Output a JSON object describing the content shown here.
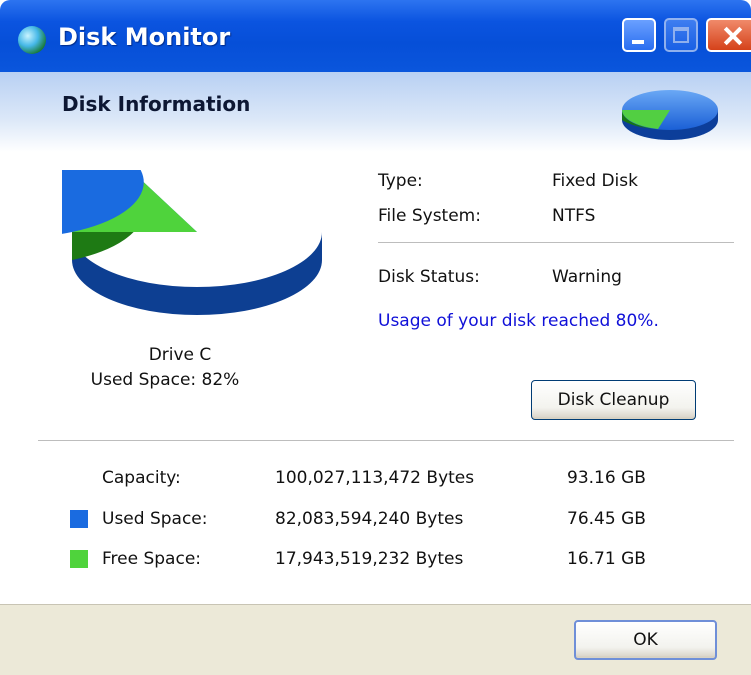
{
  "window": {
    "title": "Disk Monitor",
    "buttons": [
      "minimize",
      "maximize",
      "close"
    ]
  },
  "header": {
    "title": "Disk Information"
  },
  "drive": {
    "name": "Drive C",
    "used_label": "Used Space: 82%",
    "used_fraction": 0.82
  },
  "info": {
    "type_label": "Type:",
    "type_value": "Fixed Disk",
    "fs_label": "File System:",
    "fs_value": "NTFS",
    "status_label": "Disk Status:",
    "status_value": "Warning",
    "warning_message": "Usage of your disk reached 80%."
  },
  "actions": {
    "cleanup_label": "Disk Cleanup",
    "ok_label": "OK"
  },
  "table": {
    "rows": [
      {
        "label": "Capacity:",
        "bytes": "100,027,113,472 Bytes",
        "gb": "93.16 GB",
        "swatch": null
      },
      {
        "label": "Used Space:",
        "bytes": "82,083,594,240 Bytes",
        "gb": "76.45 GB",
        "swatch": "#1a6be0"
      },
      {
        "label": "Free Space:",
        "bytes": "17,943,519,232 Bytes",
        "gb": "16.71 GB",
        "swatch": "#4fd33c"
      }
    ]
  },
  "colors": {
    "used": "#1a6be0",
    "used_dark": "#0d3f92",
    "free": "#4fd33c",
    "free_dark": "#1e7a14",
    "warning_text": "#1010d8"
  }
}
